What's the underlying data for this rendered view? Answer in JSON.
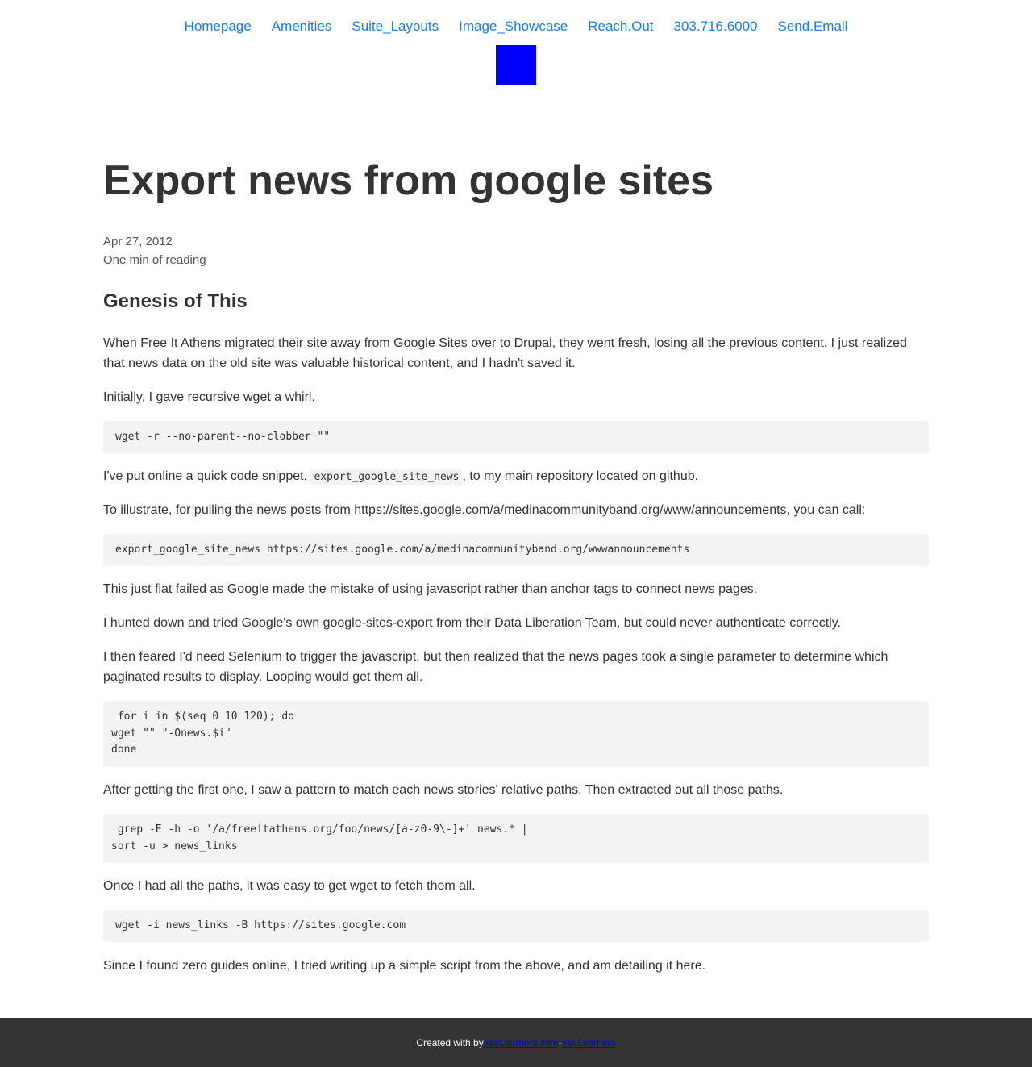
{
  "nav": {
    "links": [
      {
        "label": "Homepage"
      },
      {
        "label": "Amenities"
      },
      {
        "label": "Suite_Layouts"
      },
      {
        "label": "Image_Showcase"
      },
      {
        "label": "Reach.Out"
      },
      {
        "label": "303.716.6000"
      },
      {
        "label": "Send.Email"
      }
    ],
    "logo_color": "#0000ff",
    "link_color": "#1a7fe6"
  },
  "post": {
    "title": "Export news from google sites",
    "date": "Apr 27, 2012",
    "reading_time": "One min of reading",
    "section_heading": "Genesis of This",
    "p1": "When Free It Athens migrated their site away from Google Sites over to Drupal, they went fresh, losing all the previous content. I just realized that news data on the old site was valuable historical content, and I hadn't saved it.",
    "p2": "Initially, I gave recursive wget a whirl.",
    "code1": "wget -r --no-parent--no-clobber \"\"",
    "p3_before": "I've put online a quick code snippet, ",
    "p3_code": "export_google_site_news",
    "p3_after": ", to my main repository located on github.",
    "p4": "To illustrate, for pulling the news posts from https://sites.google.com/a/medinacommunityband.org/www/announcements, you can call:",
    "code2": "export_google_site_news https://sites.google.com/a/medinacommunityband.org/wwwannouncements",
    "p5": "This just flat failed as Google made the mistake of using javascript rather than anchor tags to connect news pages.",
    "p6": "I hunted down and tried Google's own google-sites-export from their Data Liberation Team, but could never authenticate correctly.",
    "p7": "I then feared I'd need Selenium to trigger the javascript, but then realized that the news pages took a single parameter to determine which paginated results to display. Looping would get them all.",
    "code3": " for i in $(seq 0 10 120); do\nwget \"\" \"-Onews.$i\"\ndone",
    "p8": "After getting the first one, I saw a pattern to match each news stories' relative paths. Then extracted out all those paths.",
    "code4": " grep -E -h -o '/a/freeitathens.org/foo/news/[a-z0-9\\-]+' news.* |\nsort -u > news_links",
    "p9": "Once I had all the paths, it was easy to get wget to fetch them all.",
    "code5": "wget -i news_links -B https://sites.google.com",
    "p10": "Since I found zero guides online, I tried writing up a simple script from the above, and am detailing it here."
  },
  "footer": {
    "prefix": "Created with by ",
    "link1": "YesLearners.com",
    "separator": " - ",
    "link2": "YesLearners",
    "background": "#333333"
  }
}
